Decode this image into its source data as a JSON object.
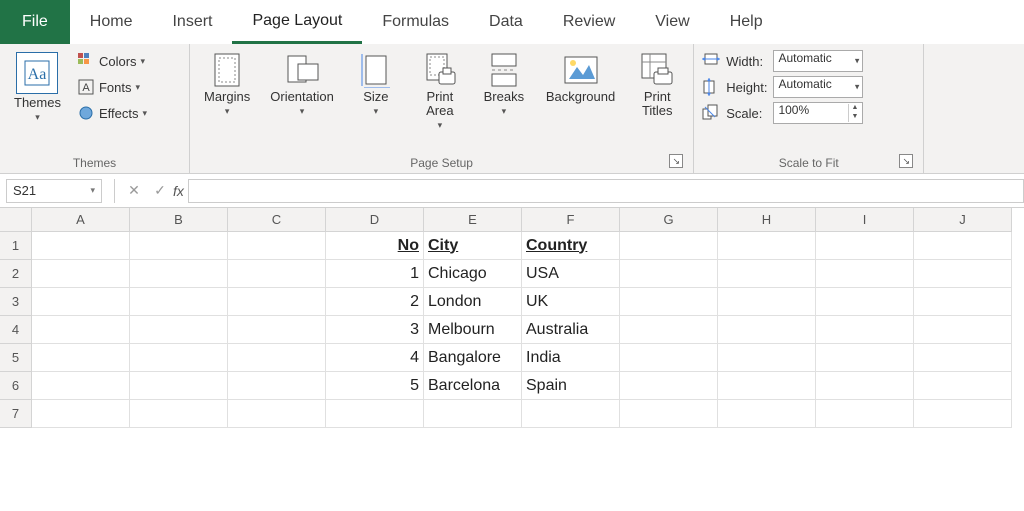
{
  "tabs": {
    "file": "File",
    "items": [
      "Home",
      "Insert",
      "Page Layout",
      "Formulas",
      "Data",
      "Review",
      "View",
      "Help"
    ],
    "active": "Page Layout"
  },
  "ribbon": {
    "themes": {
      "label": "Themes",
      "main": "Themes",
      "colors": "Colors",
      "fonts": "Fonts",
      "effects": "Effects"
    },
    "pagesetup": {
      "label": "Page Setup",
      "margins": "Margins",
      "orientation": "Orientation",
      "size": "Size",
      "printarea": "Print\nArea",
      "breaks": "Breaks",
      "background": "Background",
      "printtitles": "Print\nTitles"
    },
    "scale": {
      "label": "Scale to Fit",
      "width": "Width:",
      "height": "Height:",
      "scale": "Scale:",
      "width_val": "Automatic",
      "height_val": "Automatic",
      "scale_val": "100%"
    }
  },
  "formula_bar": {
    "namebox": "S21",
    "formula": ""
  },
  "columns": [
    "A",
    "B",
    "C",
    "D",
    "E",
    "F",
    "G",
    "H",
    "I",
    "J"
  ],
  "rows": [
    "1",
    "2",
    "3",
    "4",
    "5",
    "6",
    "7"
  ],
  "data": {
    "headers": {
      "no": "No",
      "city": "City",
      "country": "Country"
    },
    "rows": [
      {
        "no": "1",
        "city": "Chicago",
        "country": "USA"
      },
      {
        "no": "2",
        "city": "London",
        "country": "UK"
      },
      {
        "no": "3",
        "city": "Melbourn",
        "country": "Australia"
      },
      {
        "no": "4",
        "city": "Bangalore",
        "country": "India"
      },
      {
        "no": "5",
        "city": "Barcelona",
        "country": "Spain"
      }
    ]
  }
}
